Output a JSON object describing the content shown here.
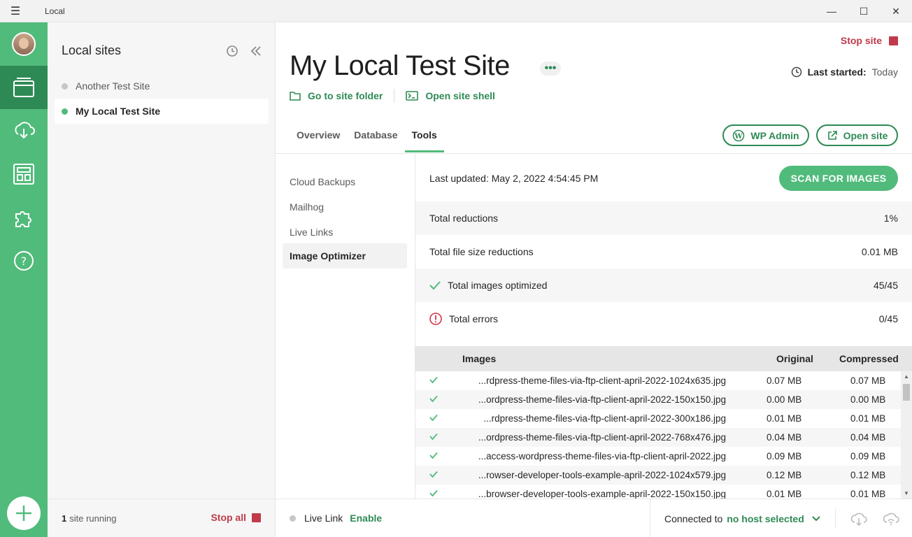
{
  "window": {
    "app_name": "Local",
    "menu_glyph": "☰",
    "minimize_glyph": "—",
    "maximize_glyph": "☐",
    "close_glyph": "✕"
  },
  "rail": {
    "items": [
      {
        "icon": "sites-icon",
        "active": true
      },
      {
        "icon": "cloud-download-icon",
        "active": false
      },
      {
        "icon": "blueprints-icon",
        "active": false
      },
      {
        "icon": "addons-puzzle-icon",
        "active": false
      },
      {
        "icon": "help-icon",
        "active": false
      }
    ],
    "add_icon": "plus-icon"
  },
  "sites_panel": {
    "title": "Local sites",
    "sites": [
      {
        "name": "Another Test Site",
        "running": false,
        "active": false
      },
      {
        "name": "My Local Test Site",
        "running": true,
        "active": true
      }
    ],
    "footer": {
      "count": "1",
      "running_text": "site running",
      "stop_all": "Stop all"
    }
  },
  "header": {
    "site_title": "My Local Test Site",
    "more_glyph": "•••",
    "stop_site": "Stop site",
    "last_started_label": "Last started:",
    "last_started_value": "Today",
    "go_to_folder": "Go to site folder",
    "open_shell": "Open site shell"
  },
  "tabs": [
    {
      "label": "Overview",
      "active": false
    },
    {
      "label": "Database",
      "active": false
    },
    {
      "label": "Tools",
      "active": true
    }
  ],
  "actions": {
    "wp_admin": "WP Admin",
    "open_site": "Open site"
  },
  "tools_nav": [
    {
      "label": "Cloud Backups",
      "active": false
    },
    {
      "label": "Mailhog",
      "active": false
    },
    {
      "label": "Live Links",
      "active": false
    },
    {
      "label": "Image Optimizer",
      "active": true
    }
  ],
  "optimizer": {
    "last_updated": "Last updated: May 2, 2022 4:54:45 PM",
    "scan_button": "SCAN FOR IMAGES",
    "stats": [
      {
        "label": "Total reductions",
        "value": "1%",
        "icon": null
      },
      {
        "label": "Total file size reductions",
        "value": "0.01 MB",
        "icon": null
      },
      {
        "label": "Total images optimized",
        "value": "45/45",
        "icon": "check-icon"
      },
      {
        "label": "Total errors",
        "value": "0/45",
        "icon": "error-icon"
      }
    ],
    "table": {
      "headers": {
        "images": "Images",
        "original": "Original",
        "compressed": "Compressed"
      },
      "rows": [
        {
          "name": "...rdpress-theme-files-via-ftp-client-april-2022-1024x635.jpg",
          "original": "0.07 MB",
          "compressed": "0.07 MB"
        },
        {
          "name": "...ordpress-theme-files-via-ftp-client-april-2022-150x150.jpg",
          "original": "0.00 MB",
          "compressed": "0.00 MB"
        },
        {
          "name": "...rdpress-theme-files-via-ftp-client-april-2022-300x186.jpg",
          "original": "0.01 MB",
          "compressed": "0.01 MB"
        },
        {
          "name": "...ordpress-theme-files-via-ftp-client-april-2022-768x476.jpg",
          "original": "0.04 MB",
          "compressed": "0.04 MB"
        },
        {
          "name": "...access-wordpress-theme-files-via-ftp-client-april-2022.jpg",
          "original": "0.09 MB",
          "compressed": "0.09 MB"
        },
        {
          "name": "...rowser-developer-tools-example-april-2022-1024x579.jpg",
          "original": "0.12 MB",
          "compressed": "0.12 MB"
        },
        {
          "name": "...browser-developer-tools-example-april-2022-150x150.jpg",
          "original": "0.01 MB",
          "compressed": "0.01 MB"
        }
      ]
    }
  },
  "bottom_bar": {
    "live_link_label": "Live Link",
    "live_link_action": "Enable",
    "connected_label": "Connected to",
    "host": "no host selected"
  },
  "colors": {
    "brand_green": "#51bb7b",
    "dark_green": "#2e8a55",
    "stop_red": "#c03a4b",
    "error_red": "#d6334a"
  }
}
